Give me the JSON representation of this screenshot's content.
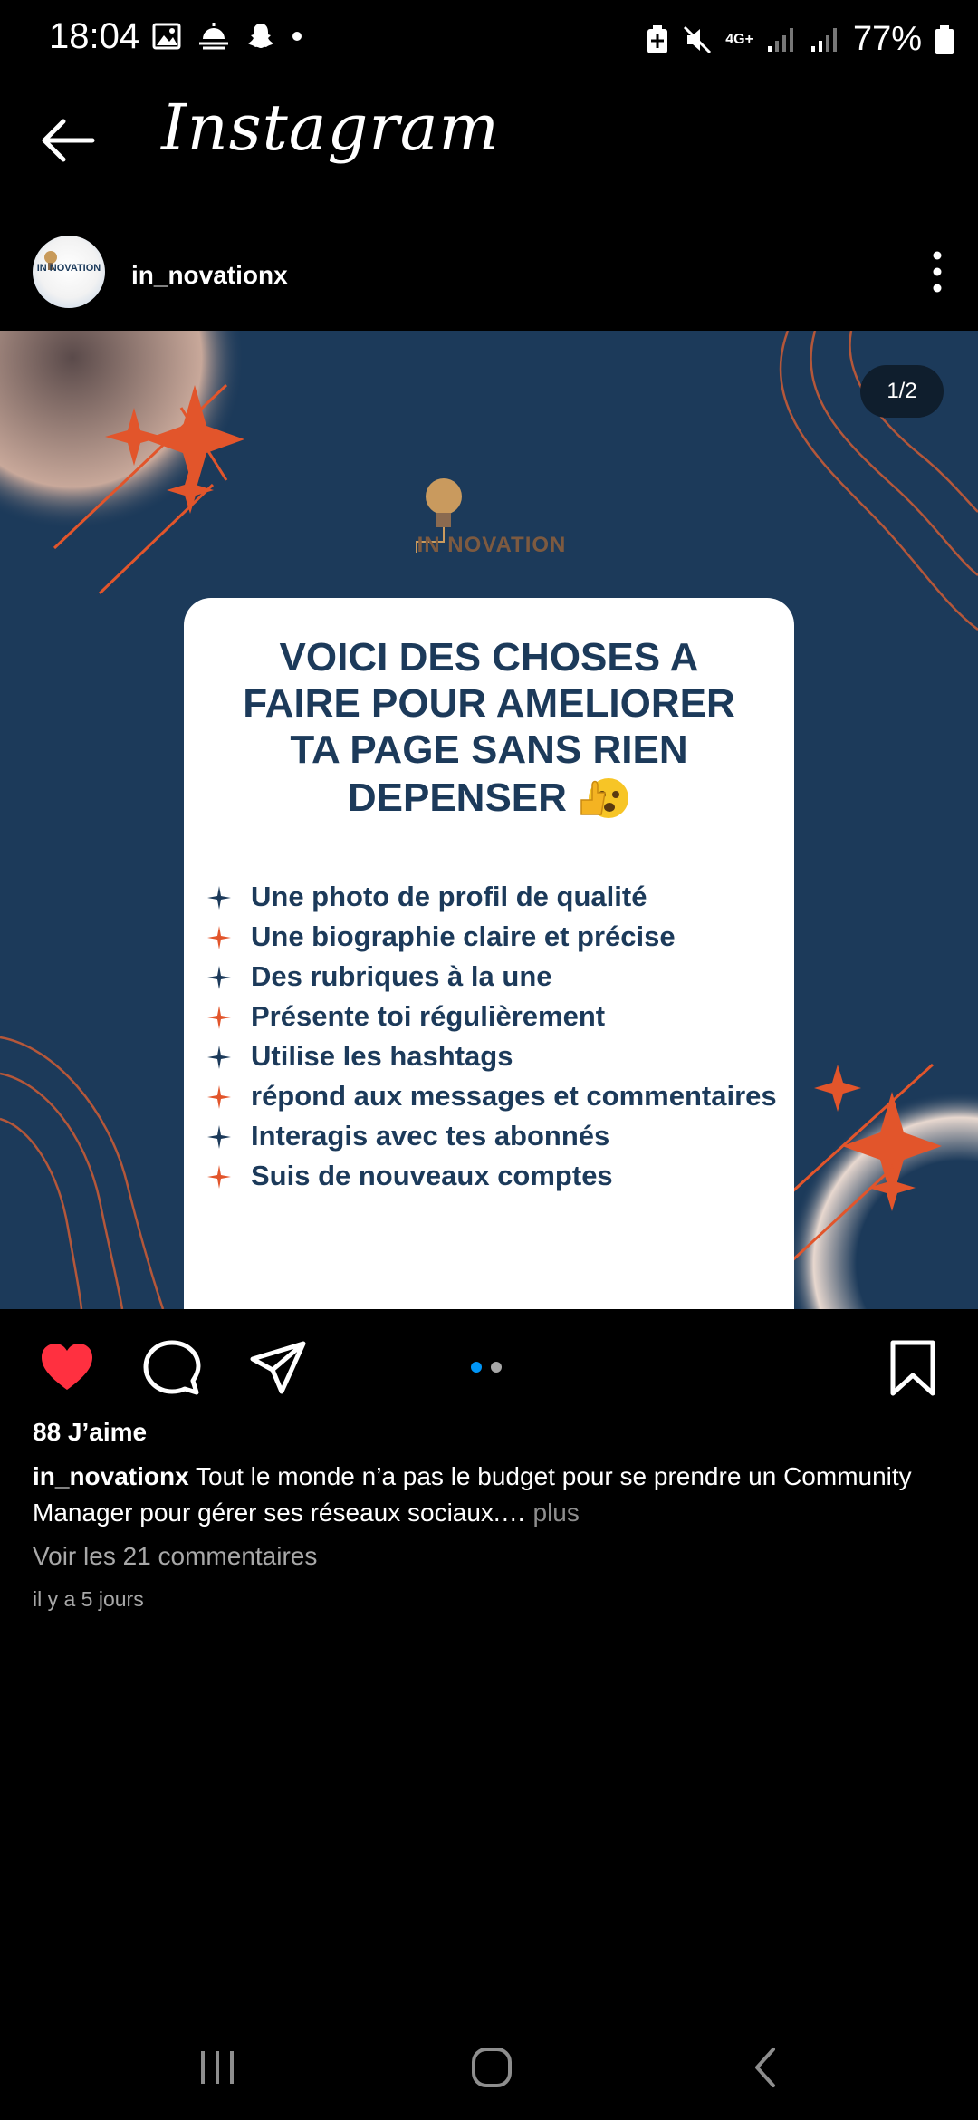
{
  "status_bar": {
    "time": "18:04",
    "network": "4G+",
    "battery": "77%"
  },
  "header": {
    "title": "Instagram"
  },
  "post": {
    "username": "in_novationx",
    "avatar_text": "IN NOVATION",
    "image": {
      "counter": "1/2",
      "brand": "IN NOVATION",
      "title_lines": [
        "VOICI DES CHOSES A",
        "FAIRE POUR AMELIORER",
        "TA PAGE SANS RIEN",
        "DEPENSER"
      ],
      "tips": [
        "Une photo de profil de qualité",
        "Une biographie claire et précise",
        "Des rubriques à la une",
        "Présente toi régulièrement",
        "Utilise les hashtags",
        "répond aux messages et commentaires",
        "Interagis avec tes abonnés",
        "Suis de nouveaux comptes"
      ],
      "colors": {
        "background": "#1c3a5a",
        "accent": "#e2552b",
        "card": "#ffffff"
      }
    },
    "likes": "88 J’aime",
    "caption_user": "in_novationx",
    "caption_text": " Tout le monde n’a pas le budget pour se prendre un Community Manager pour gérer ses réseaux sociaux.…",
    "caption_more": " plus",
    "comments_link": "Voir les 21 commentaires",
    "time_ago": "il y a 5 jours",
    "carousel": {
      "count": 2,
      "active": 1
    }
  },
  "icons": {
    "like": "heart-filled-icon",
    "comment": "comment-icon",
    "share": "send-icon",
    "save": "bookmark-icon",
    "like_color": "#ff3040",
    "dot_active": "#0095f6"
  }
}
